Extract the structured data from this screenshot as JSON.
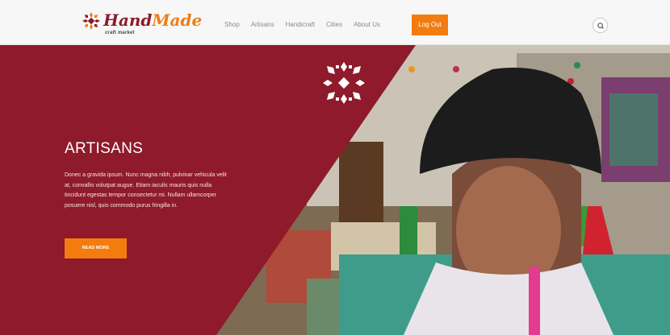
{
  "brand": {
    "name_part1": "Hand",
    "name_part2": "Made",
    "tagline": "craft market",
    "maroon_color": "#8e1a2b",
    "orange_color": "#f47c0f"
  },
  "nav": {
    "items": [
      {
        "label": "Shop"
      },
      {
        "label": "Artisans"
      },
      {
        "label": "Handicraft"
      },
      {
        "label": "Cities"
      },
      {
        "label": "About Us"
      }
    ],
    "logout_label": "Log Out",
    "search_icon": "search-icon"
  },
  "hero": {
    "title": "ARTISANS",
    "description": "Donec a gravida ipsum. Nunc magna nibh, pulvinar vehicula velit at, convallis volutpat augue. Etiam iaculis mauris quis nulla tincidunt egestas tempor consectetur mi. Nullam ullamcorper posuere nisl, quis commodo purus fringilla in.",
    "button_label": "READ MORE",
    "emblem_icon": "snowflake-icon"
  }
}
